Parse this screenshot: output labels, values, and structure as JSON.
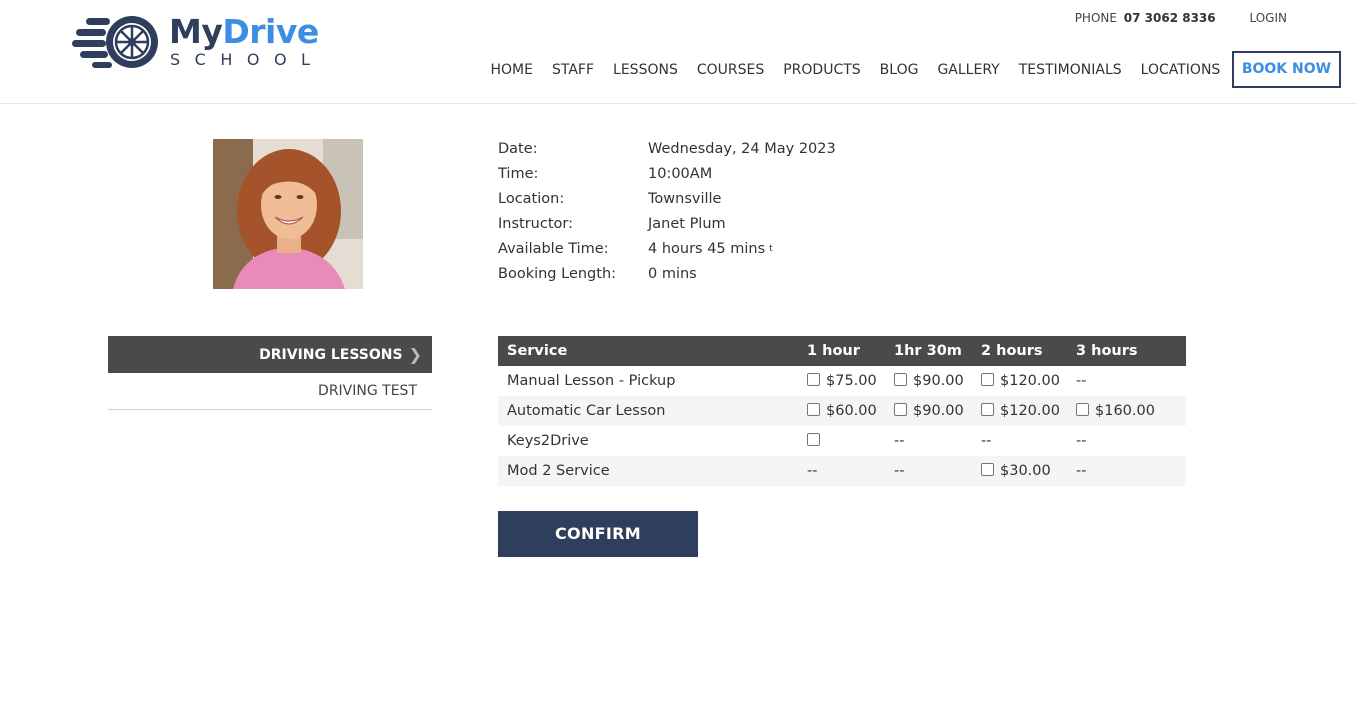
{
  "brand": {
    "name_part1": "My",
    "name_part2": "Drive",
    "tagline": "SCHOOL",
    "colors": {
      "navy": "#2f3e5c",
      "blue": "#3c8fe0"
    }
  },
  "topbar": {
    "phone_label": "PHONE",
    "phone_number": "07 3062 8336",
    "login_label": "LOGIN"
  },
  "nav": {
    "items": [
      "HOME",
      "STAFF",
      "LESSONS",
      "COURSES",
      "PRODUCTS",
      "BLOG",
      "GALLERY",
      "TESTIMONIALS",
      "LOCATIONS"
    ],
    "book_now": "BOOK NOW"
  },
  "details": {
    "date_label": "Date:",
    "date_value": "Wednesday, 24 May 2023",
    "time_label": "Time:",
    "time_value": "10:00AM",
    "location_label": "Location:",
    "location_value": "Townsville",
    "instructor_label": "Instructor:",
    "instructor_value": "Janet Plum",
    "available_label": "Available Time:",
    "available_value": "4 hours 45 mins",
    "available_mark": "t",
    "booking_label": "Booking Length:",
    "booking_value": "0 mins"
  },
  "sidemenu": {
    "active": "DRIVING LESSONS",
    "items": [
      "DRIVING TEST"
    ]
  },
  "table": {
    "headers": [
      "Service",
      "1 hour",
      "1hr 30m",
      "2 hours",
      "3 hours"
    ],
    "rows": [
      {
        "service": "Manual Lesson - Pickup",
        "cells": [
          {
            "checkbox": true,
            "price": "$75.00"
          },
          {
            "checkbox": true,
            "price": "$90.00"
          },
          {
            "checkbox": true,
            "price": "$120.00"
          },
          {
            "checkbox": false,
            "price": "--"
          }
        ]
      },
      {
        "service": "Automatic Car Lesson",
        "cells": [
          {
            "checkbox": true,
            "price": "$60.00"
          },
          {
            "checkbox": true,
            "price": "$90.00"
          },
          {
            "checkbox": true,
            "price": "$120.00"
          },
          {
            "checkbox": true,
            "price": "$160.00"
          }
        ]
      },
      {
        "service": "Keys2Drive",
        "cells": [
          {
            "checkbox": true,
            "price": ""
          },
          {
            "checkbox": false,
            "price": "--"
          },
          {
            "checkbox": false,
            "price": "--"
          },
          {
            "checkbox": false,
            "price": "--"
          }
        ]
      },
      {
        "service": "Mod 2 Service",
        "cells": [
          {
            "checkbox": false,
            "price": "--"
          },
          {
            "checkbox": false,
            "price": "--"
          },
          {
            "checkbox": true,
            "price": "$30.00"
          },
          {
            "checkbox": false,
            "price": "--"
          }
        ]
      }
    ]
  },
  "confirm_label": "CONFIRM"
}
